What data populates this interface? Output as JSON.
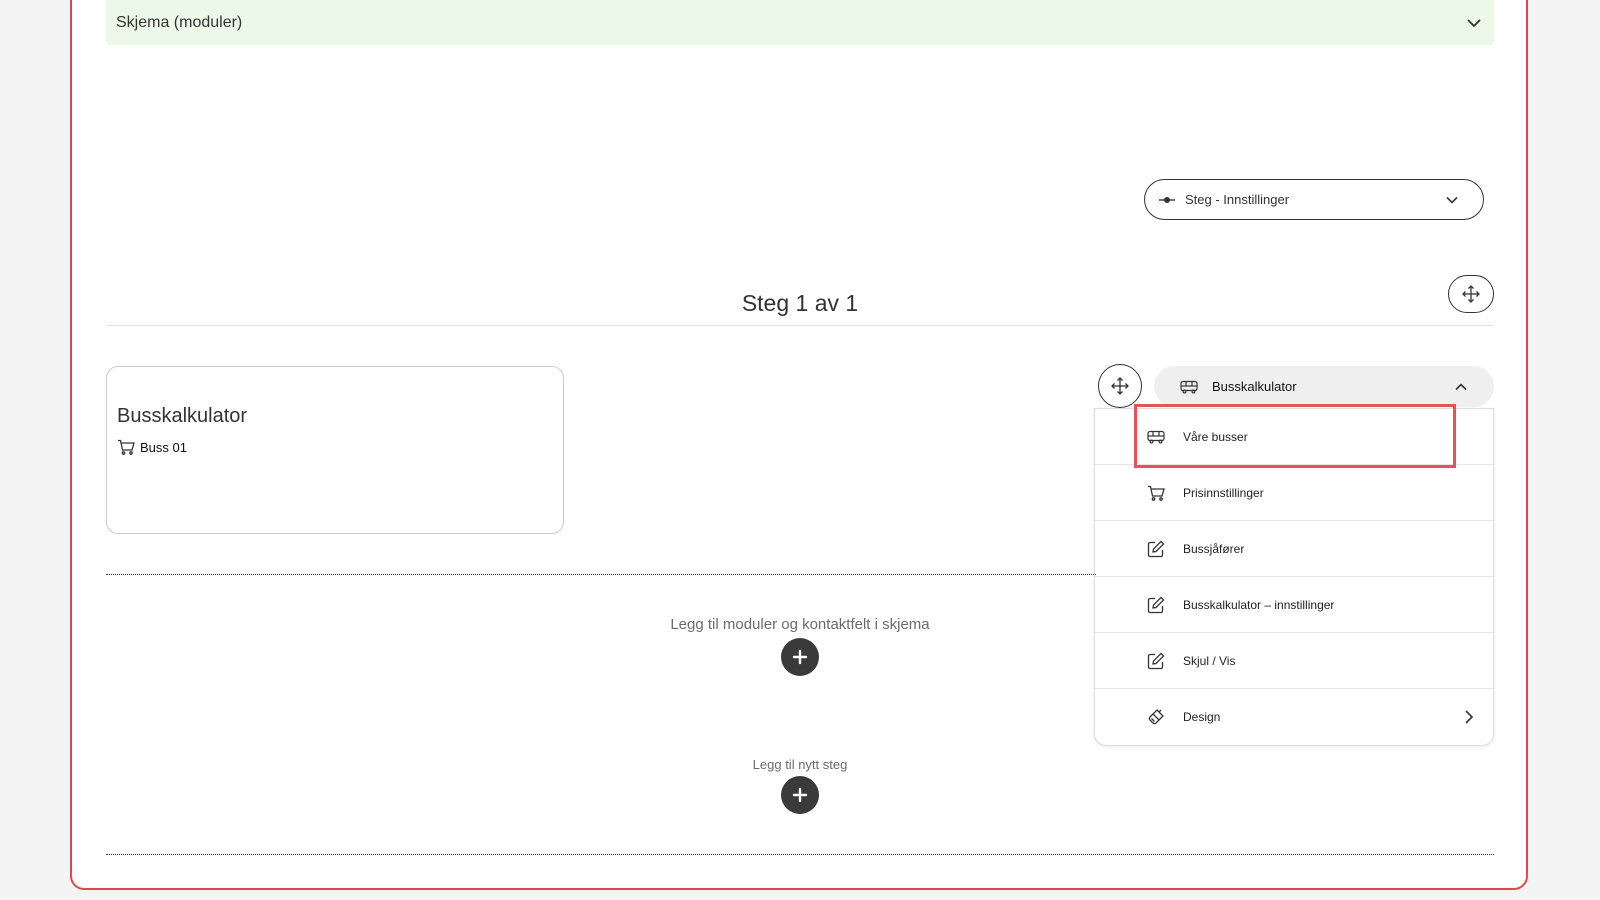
{
  "accordion": {
    "title": "Skjema (moduler)"
  },
  "step_settings": {
    "label": "Steg - Innstillinger"
  },
  "step": {
    "heading": "Steg 1 av 1"
  },
  "module_card": {
    "title": "Busskalkulator",
    "item_label": "Buss 01"
  },
  "module_menu": {
    "title": "Busskalkulator",
    "items": [
      {
        "label": "Våre busser",
        "icon": "bus-icon"
      },
      {
        "label": "Prisinnstillinger",
        "icon": "cart-icon"
      },
      {
        "label": "Bussjåfører",
        "icon": "edit-icon"
      },
      {
        "label": "Busskalkulator – innstillinger",
        "icon": "edit-icon"
      },
      {
        "label": "Skjul / Vis",
        "icon": "edit-icon"
      },
      {
        "label": "Design",
        "icon": "brush-icon"
      }
    ]
  },
  "add_modules": {
    "label": "Legg til moduler og kontaktfelt i skjema"
  },
  "add_step": {
    "label": "Legg til nytt steg"
  },
  "colors": {
    "frame_border": "#e2474b",
    "accordion_bg": "#edf9e8",
    "highlight": "#e0545a",
    "plus_bg": "#3a3a3a"
  }
}
